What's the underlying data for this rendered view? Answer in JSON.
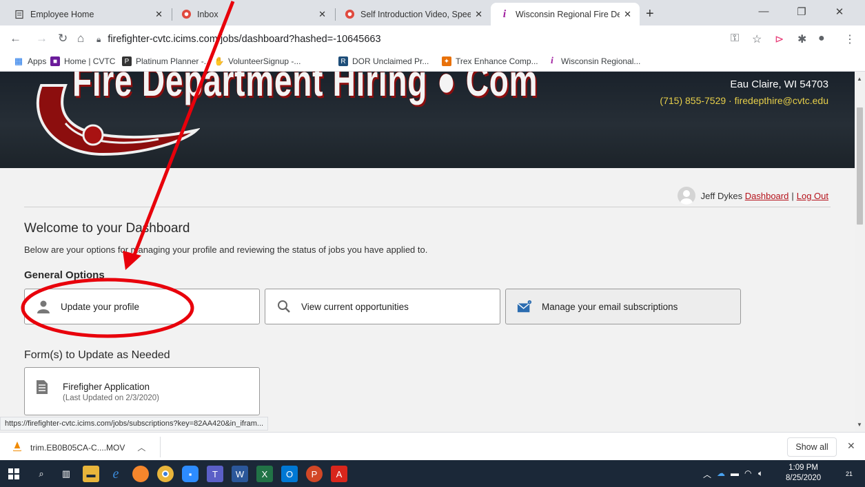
{
  "tabs": [
    {
      "title": "Employee Home",
      "icon": "page-icon"
    },
    {
      "title": "Inbox",
      "icon": "mail-icon"
    },
    {
      "title": "Self Introduction Video, SpeedGr",
      "icon": "canvas-icon"
    },
    {
      "title": "Wisconsin Regional Fire Departm",
      "icon": "info-icon"
    }
  ],
  "address": {
    "url": "firefighter-cvtc.icims.com/jobs/dashboard?hashed=-10645663"
  },
  "bookmarks": [
    {
      "label": "Apps",
      "color": "#1a73e8"
    },
    {
      "label": "Home | CVTC",
      "color": "#6a1b9a"
    },
    {
      "label": "Platinum Planner -...",
      "color": "#333333"
    },
    {
      "label": "VolunteerSignup -...",
      "color": "#c7a86a"
    },
    {
      "label": "DOR Unclaimed Pr...",
      "color": "#1e4e79"
    },
    {
      "label": "Trex Enhance Comp...",
      "color": "#e8710a"
    },
    {
      "label": "Wisconsin Regional...",
      "color": "#a020a0"
    }
  ],
  "banner": {
    "logo_text": "Fire Department Hiring ● Com",
    "address_line": "Eau Claire, WI 54703",
    "contact_line": "(715) 855-7529 · firedepthire@cvtc.edu"
  },
  "user": {
    "name": "Jeff Dykes",
    "dashboard_link": "Dashboard",
    "separator": "|",
    "logout_link": "Log Out"
  },
  "dashboard": {
    "title": "Welcome to your Dashboard",
    "description": "Below are your options for managing your profile and reviewing the status of jobs you have applied to.",
    "general_heading": "General Options",
    "options": [
      {
        "label": "Update your profile",
        "icon": "person-icon"
      },
      {
        "label": "View current opportunities",
        "icon": "search-icon"
      },
      {
        "label": "Manage your email subscriptions",
        "icon": "email-icon"
      }
    ],
    "forms_heading": "Form(s) to Update as Needed",
    "form": {
      "title": "Firefigher Application",
      "updated": "(Last Updated on 2/3/2020)"
    }
  },
  "status_url": "https://firefighter-cvtc.icims.com/jobs/subscriptions?key=82AA420&in_ifram...",
  "download": {
    "filename": "trim.EB0B05CA-C....MOV",
    "show_all": "Show all"
  },
  "taskbar": {
    "time": "1:09 PM",
    "date": "8/25/2020",
    "notifications": "21"
  },
  "colors": {
    "brand_red": "#b5121b",
    "annotation_red": "#e8000b",
    "accent_yellow": "#e7cf4a"
  }
}
